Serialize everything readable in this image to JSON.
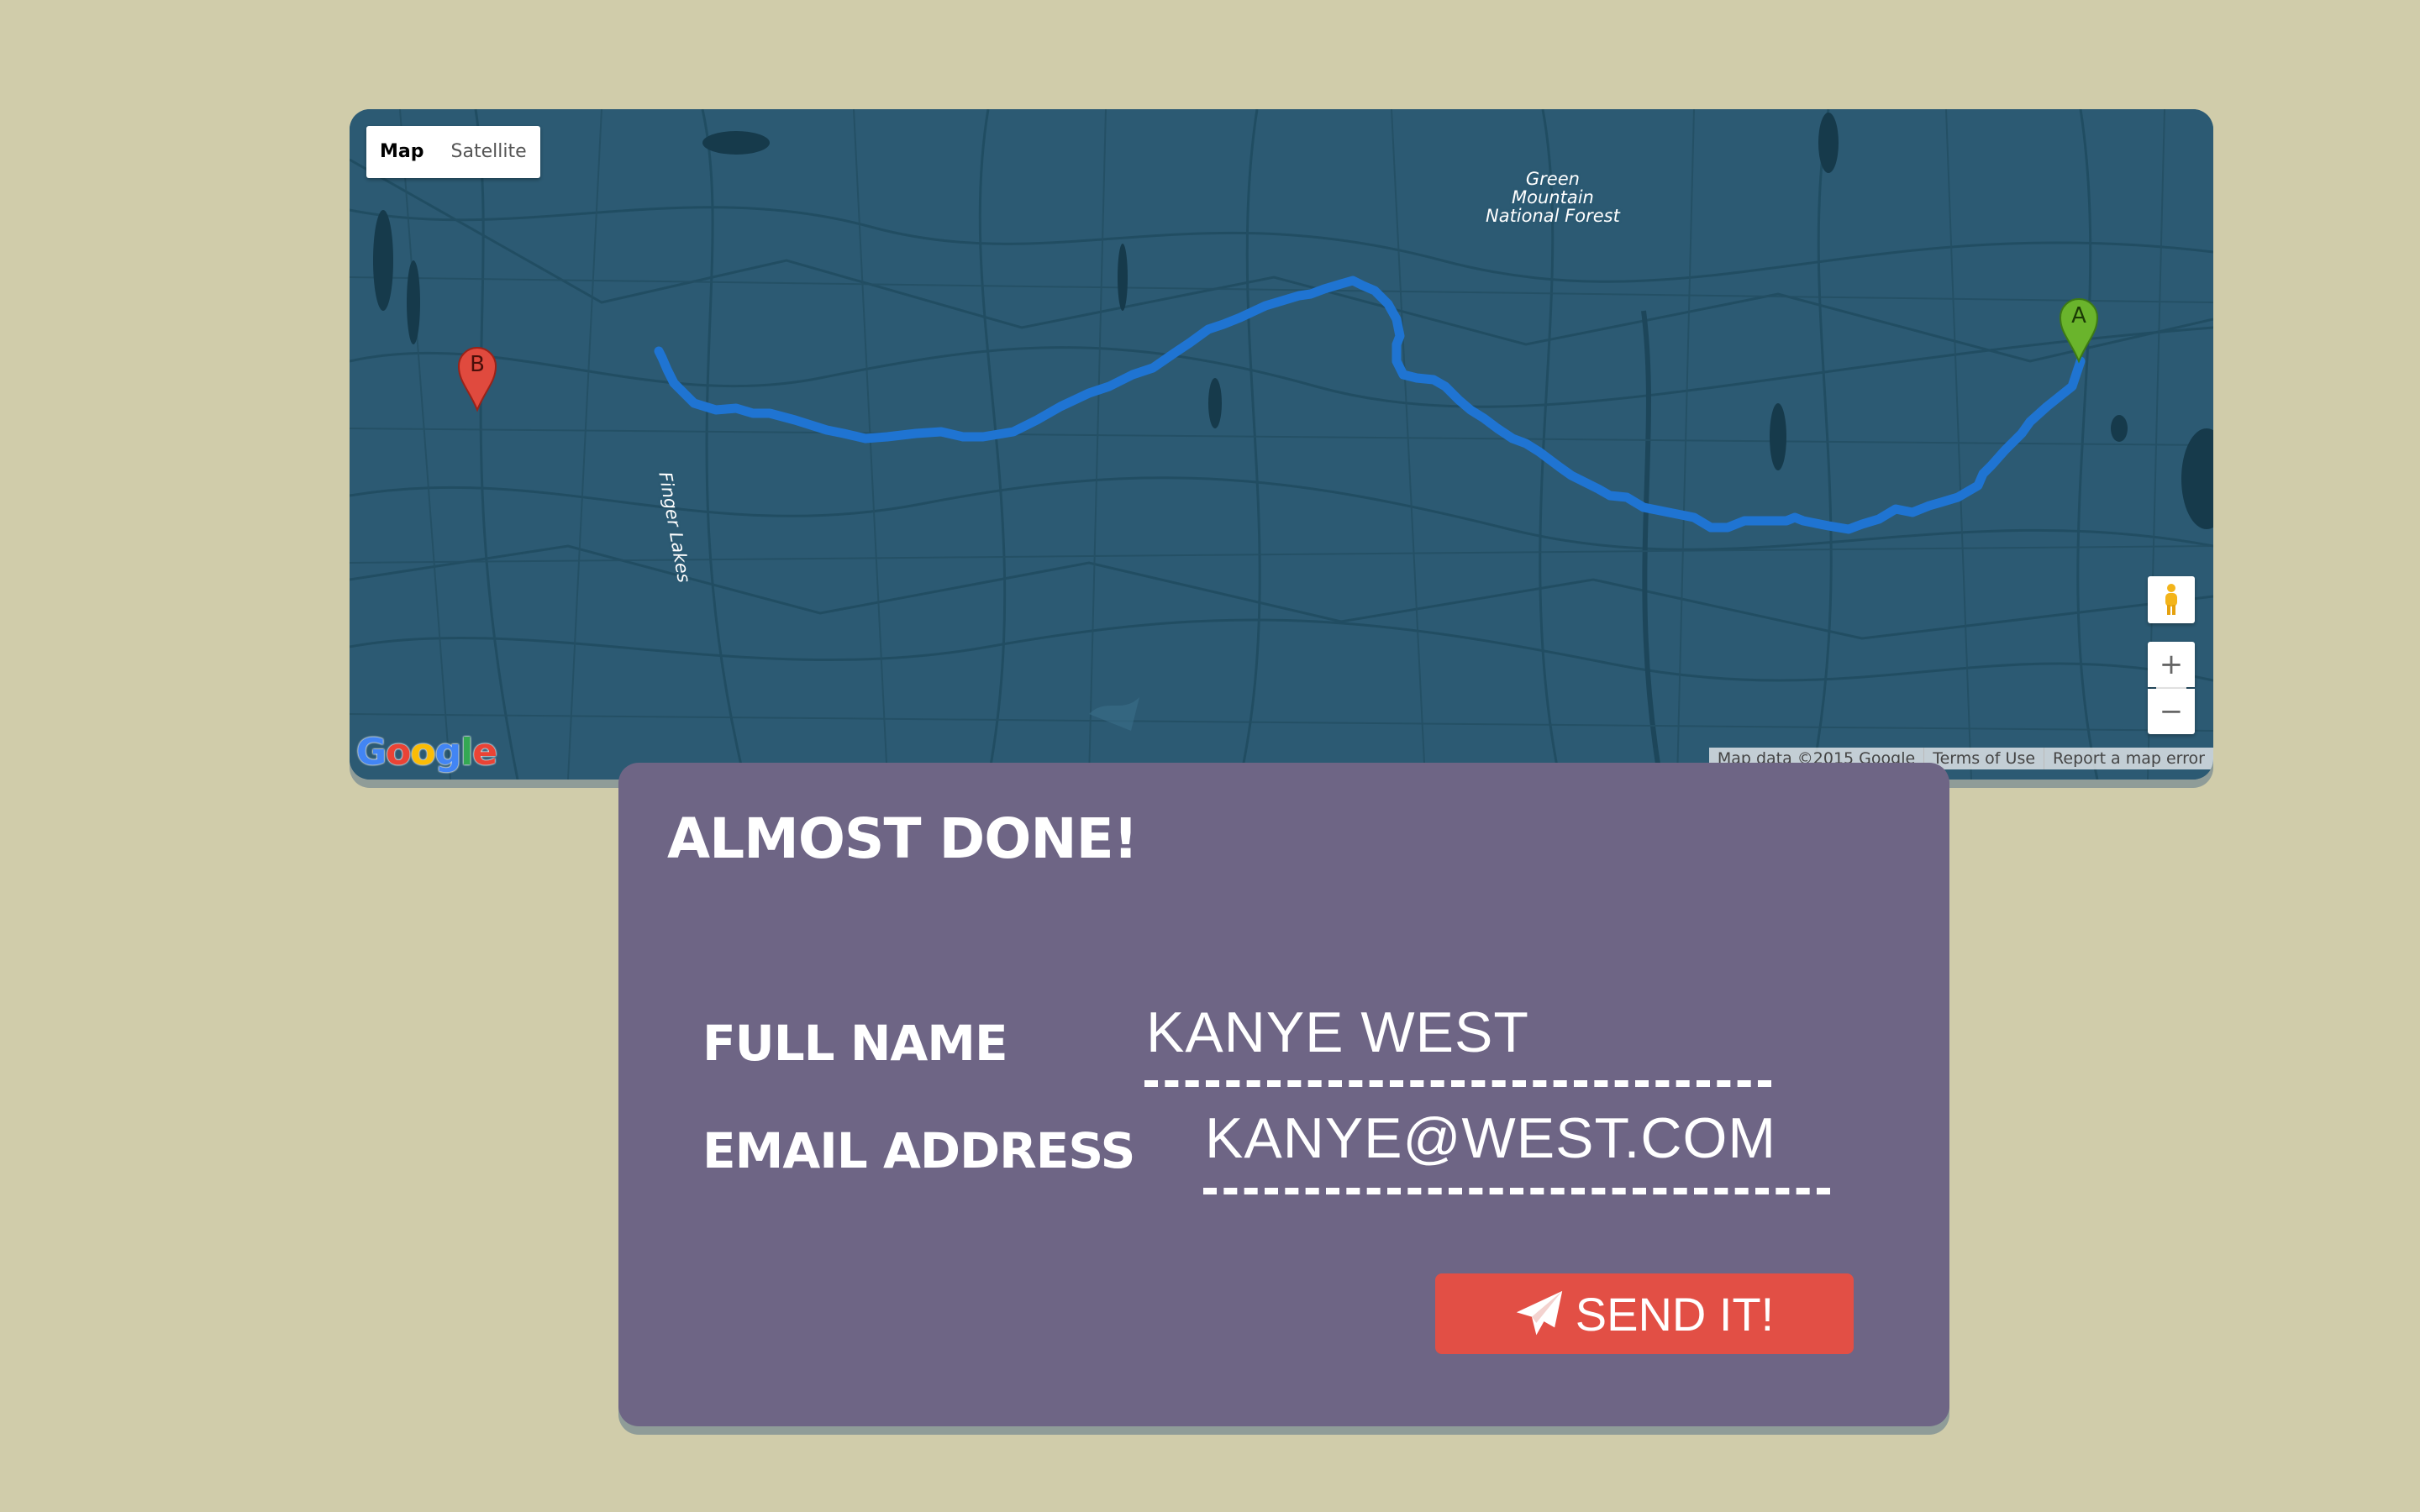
{
  "map": {
    "type_controls": {
      "map_label": "Map",
      "satellite_label": "Satellite"
    },
    "labels": {
      "forest": "Green\nMountain\nNational Forest",
      "lakes": "Finger Lakes"
    },
    "markers": {
      "start": "A",
      "end": "B"
    },
    "controls": {
      "zoom_in": "+",
      "zoom_out": "−"
    },
    "logo": "Google",
    "attribution": {
      "data": "Map data ©2015 Google",
      "terms": "Terms of Use",
      "report": "Report a map error"
    },
    "colors": {
      "water": "#2c5a73",
      "route": "#1f74d2",
      "marker_a": "#6ab42c",
      "marker_b": "#e04a3e"
    }
  },
  "form": {
    "title": "ALMOST DONE!",
    "full_name_label": "FULL NAME",
    "full_name_value": "KANYE WEST",
    "email_label": "EMAIL ADDRESS",
    "email_value": "KANYE@WEST.COM",
    "send_label": "SEND IT!",
    "send_icon": "paper-plane-icon",
    "colors": {
      "card": "#6e6585",
      "button": "#e24f45",
      "background": "#d0ccaa"
    }
  }
}
